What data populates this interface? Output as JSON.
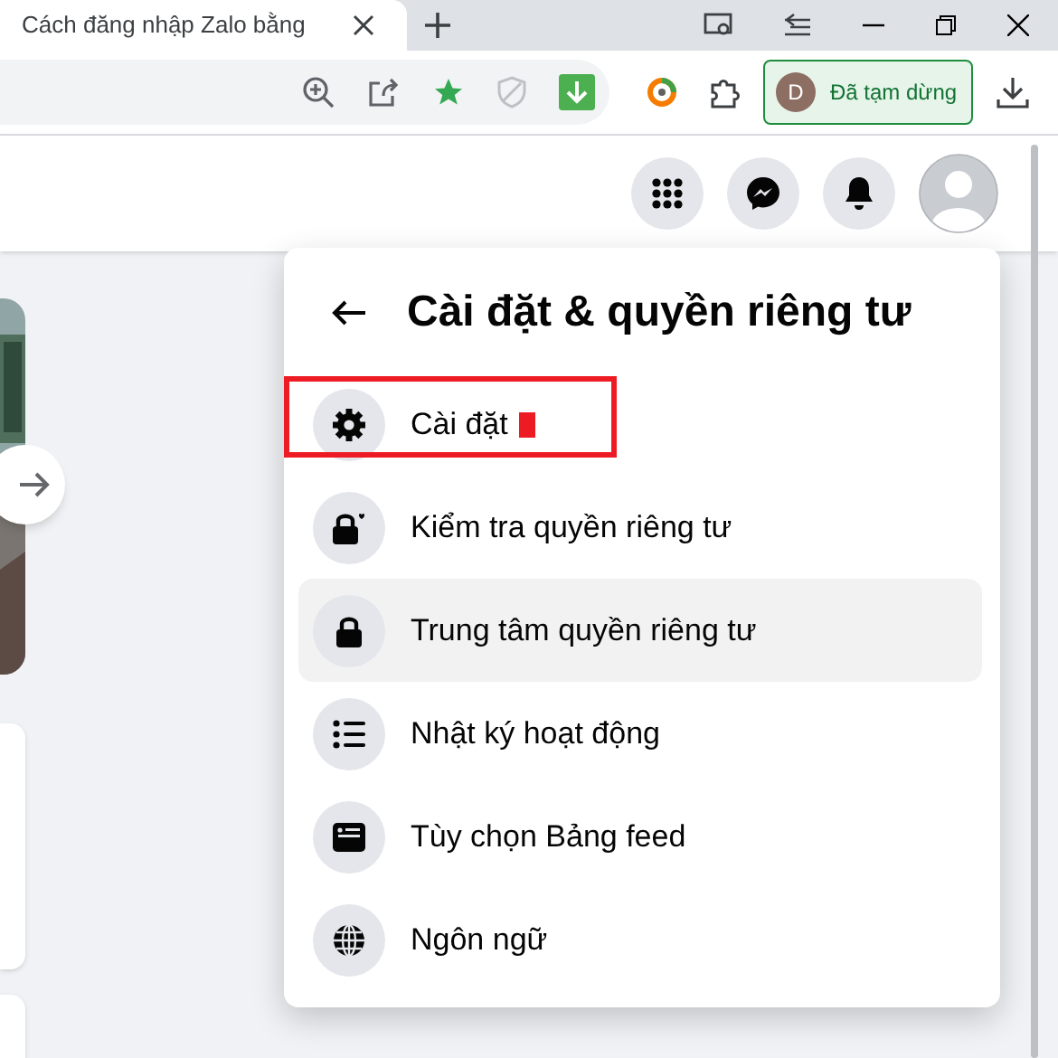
{
  "browser": {
    "tab_title": "Cách đăng nhập Zalo bằng",
    "profile": {
      "initial": "D",
      "status": "Đã tạm dừng"
    }
  },
  "menu": {
    "title": "Cài đặt & quyền riêng tư",
    "items": [
      {
        "label": "Cài đặt",
        "hovered": false,
        "outlined": true
      },
      {
        "label": "Kiểm tra quyền riêng tư",
        "hovered": false,
        "outlined": false
      },
      {
        "label": "Trung tâm quyền riêng tư",
        "hovered": true,
        "outlined": false
      },
      {
        "label": "Nhật ký hoạt động",
        "hovered": false,
        "outlined": false
      },
      {
        "label": "Tùy chọn Bảng feed",
        "hovered": false,
        "outlined": false
      },
      {
        "label": "Ngôn ngữ",
        "hovered": false,
        "outlined": false
      }
    ]
  }
}
